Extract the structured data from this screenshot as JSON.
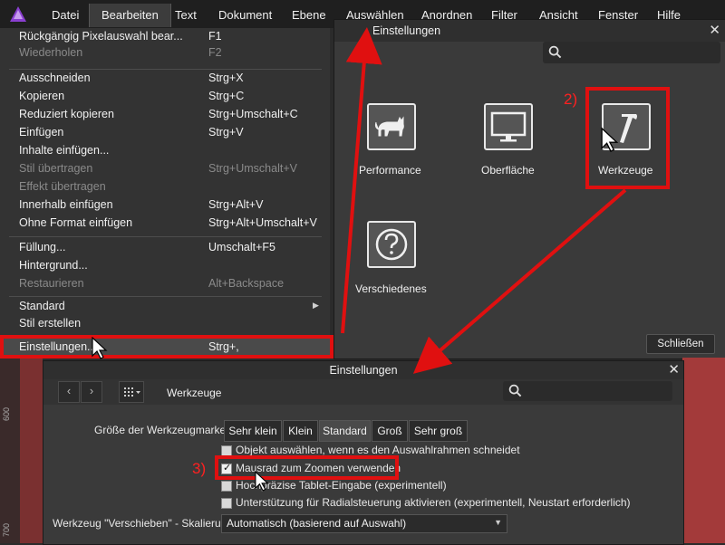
{
  "menubar": {
    "items": [
      {
        "label": "Datei"
      },
      {
        "label": "Bearbeiten"
      },
      {
        "label": "Text"
      },
      {
        "label": "Dokument"
      },
      {
        "label": "Ebene"
      },
      {
        "label": "Auswählen"
      },
      {
        "label": "Anordnen"
      },
      {
        "label": "Filter"
      },
      {
        "label": "Ansicht"
      },
      {
        "label": "Fenster"
      },
      {
        "label": "Hilfe"
      }
    ]
  },
  "edit_menu": {
    "items": [
      {
        "label": "Rückgängig Pixelauswahl bear...",
        "shortcut": "F1",
        "enabled": true
      },
      {
        "label": "Wiederholen",
        "shortcut": "F2",
        "enabled": false
      },
      {
        "label": "Ausschneiden",
        "shortcut": "Strg+X",
        "enabled": true
      },
      {
        "label": "Kopieren",
        "shortcut": "Strg+C",
        "enabled": true
      },
      {
        "label": "Reduziert kopieren",
        "shortcut": "Strg+Umschalt+C",
        "enabled": true
      },
      {
        "label": "Einfügen",
        "shortcut": "Strg+V",
        "enabled": true
      },
      {
        "label": "Inhalte einfügen...",
        "shortcut": "",
        "enabled": true
      },
      {
        "label": "Stil übertragen",
        "shortcut": "Strg+Umschalt+V",
        "enabled": false
      },
      {
        "label": "Effekt übertragen",
        "shortcut": "",
        "enabled": false
      },
      {
        "label": "Innerhalb einfügen",
        "shortcut": "Strg+Alt+V",
        "enabled": true
      },
      {
        "label": "Ohne Format einfügen",
        "shortcut": "Strg+Alt+Umschalt+V",
        "enabled": true
      },
      {
        "label": "Füllung...",
        "shortcut": "Umschalt+F5",
        "enabled": true
      },
      {
        "label": "Hintergrund...",
        "shortcut": "",
        "enabled": true
      },
      {
        "label": "Restaurieren",
        "shortcut": "Alt+Backspace",
        "enabled": false
      },
      {
        "label": "Standard",
        "shortcut": "",
        "enabled": true
      },
      {
        "label": "Stil erstellen",
        "shortcut": "",
        "enabled": true
      },
      {
        "label": "Einstellungen...",
        "shortcut": "Strg+,",
        "enabled": true
      }
    ]
  },
  "prefs_dialog": {
    "title": "Einstellungen",
    "categories": [
      {
        "label": "Performance",
        "icon": "cat-icon"
      },
      {
        "label": "Oberfläche",
        "icon": "monitor-icon"
      },
      {
        "label": "Werkzeuge",
        "icon": "hammer-icon"
      },
      {
        "label": "Verschiedenes",
        "icon": "question-icon"
      }
    ],
    "close_button": "Schließen"
  },
  "tools_dialog": {
    "title": "Einstellungen",
    "section": "Werkzeuge",
    "size_label": "Größe der Werkzeugmarker:",
    "size_options": [
      "Sehr klein",
      "Klein",
      "Standard",
      "Groß",
      "Sehr groß"
    ],
    "size_selected": "Standard",
    "checkboxes": [
      {
        "label": "Objekt auswählen, wenn es den Auswahlrahmen schneidet",
        "checked": false
      },
      {
        "label": "Mausrad zum Zoomen verwenden",
        "checked": true
      },
      {
        "label": "Hochpräzise Tablet-Eingabe (experimentell)",
        "checked": false
      },
      {
        "label": "Unterstützung für Radialsteuerung aktivieren (experimentell, Neustart erforderlich)",
        "checked": false
      }
    ],
    "move_label": "Werkzeug \"Verschieben\" - Skalierung:",
    "move_value": "Automatisch (basierend auf Auswahl)"
  },
  "ruler": {
    "ticks": [
      "600",
      "700"
    ]
  },
  "annotations": {
    "step2": "2)",
    "step3": "3)"
  },
  "colors": {
    "annotation": "#e01010",
    "menubar": "#1f1f1f",
    "panel": "#3a3a3a"
  }
}
